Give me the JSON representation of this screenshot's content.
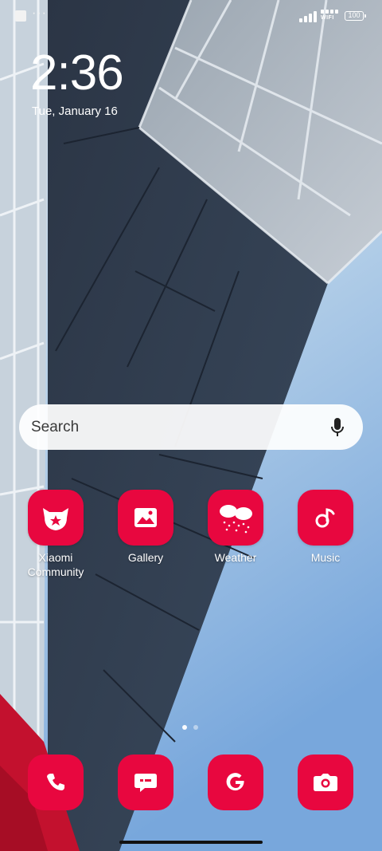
{
  "status_bar": {
    "left_icons": [
      "notification-square-icon",
      "more-dots-icon"
    ],
    "dots": "···",
    "network_label": "WIFI",
    "battery": "100"
  },
  "lockscreen": {
    "time": "2:36",
    "date": "Tue, January 16"
  },
  "search": {
    "label": "Search",
    "icon": "mic-icon"
  },
  "apps": [
    {
      "label": "Xiaomi Community",
      "icon": "xiaomi-community-icon"
    },
    {
      "label": "Gallery",
      "icon": "gallery-icon"
    },
    {
      "label": "Weather",
      "icon": "weather-icon"
    },
    {
      "label": "Music",
      "icon": "music-icon"
    }
  ],
  "pager": {
    "pages": 2,
    "current": 1
  },
  "dock": [
    {
      "icon": "phone-icon"
    },
    {
      "icon": "messages-icon"
    },
    {
      "icon": "google-icon"
    },
    {
      "icon": "camera-icon"
    }
  ],
  "colors": {
    "app_tile": "#e8073f",
    "background": "#b9d2e8"
  }
}
